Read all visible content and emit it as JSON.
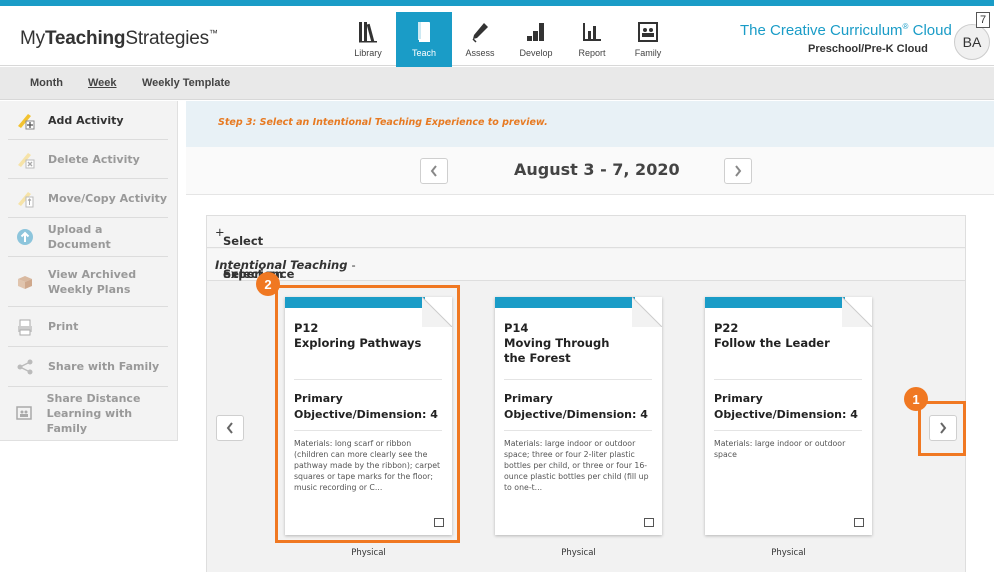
{
  "header": {
    "logo_light": "My",
    "logo_bold": "Teaching",
    "logo_end": "Strategies",
    "logo_tm": "™",
    "nav": [
      {
        "label": "Library",
        "icon": "library-icon"
      },
      {
        "label": "Teach",
        "icon": "book-icon",
        "active": true
      },
      {
        "label": "Assess",
        "icon": "pencil-icon"
      },
      {
        "label": "Develop",
        "icon": "stairs-icon"
      },
      {
        "label": "Report",
        "icon": "bar-chart-icon"
      },
      {
        "label": "Family",
        "icon": "family-photo-icon"
      }
    ],
    "product_title": "The Creative Curriculum",
    "product_reg": "®",
    "product_cloud": " Cloud",
    "product_sub": "Preschool/Pre-K Cloud",
    "avatar": "BA",
    "notification_count": "7"
  },
  "subnav": {
    "month": "Month",
    "week": "Week",
    "template": "Weekly Template"
  },
  "sidebar": {
    "items": [
      {
        "label": "Add Activity",
        "icon": "add-activity-icon"
      },
      {
        "label": "Delete Activity",
        "icon": "delete-activity-icon"
      },
      {
        "label": "Move/Copy Activity",
        "icon": "move-copy-icon"
      },
      {
        "label": "Upload a Document",
        "icon": "upload-icon"
      },
      {
        "label_line1": "View Archived",
        "label_line2": "Weekly Plans",
        "icon": "archive-icon"
      },
      {
        "label": "Print",
        "icon": "print-icon"
      },
      {
        "label": "Share with Family",
        "icon": "share-icon"
      },
      {
        "label_line1": "Share Distance",
        "label_line2": "Learning with Family",
        "icon": "family-photo-icon"
      }
    ]
  },
  "main": {
    "step_text": "Step 3: Select an Intentional Teaching Experience to preview.",
    "week_title": "August 3 - 7, 2020",
    "objectives_row": "Select Objectives/Dimensions from Class Profile",
    "objectives_toggle": "+",
    "experience_prefix": "Select an ",
    "experience_italic": "Intentional Teaching",
    "experience_suffix": " experience",
    "experience_toggle": "-",
    "cards": [
      {
        "code": "P12",
        "title": "Exploring Pathways",
        "obj_line1": "Primary",
        "obj_line2": "Objective/Dimension: 4",
        "materials": "Materials: long scarf or ribbon (children can more clearly see the pathway made by the ribbon); carpet squares or tape marks for the floor; music recording or C...",
        "category": "Physical"
      },
      {
        "code": "P14",
        "title": "Moving Through the Forest",
        "obj_line1": "Primary",
        "obj_line2": "Objective/Dimension: 4",
        "materials": "Materials: large indoor or outdoor space; three or four 2-liter plastic bottles per child, or three or four 16-ounce plastic bottles per child (fill up to one-t...",
        "category": "Physical"
      },
      {
        "code": "P22",
        "title": "Follow the Leader",
        "obj_line1": "Primary",
        "obj_line2": "Objective/Dimension: 4",
        "materials": "Materials: large indoor or outdoor space",
        "category": "Physical"
      }
    ]
  },
  "annotations": {
    "badge_1": "1",
    "badge_2": "2",
    "highlight_color": "#f07822"
  },
  "colors": {
    "brand": "#1a9cc7",
    "step_text": "#e77a22"
  }
}
